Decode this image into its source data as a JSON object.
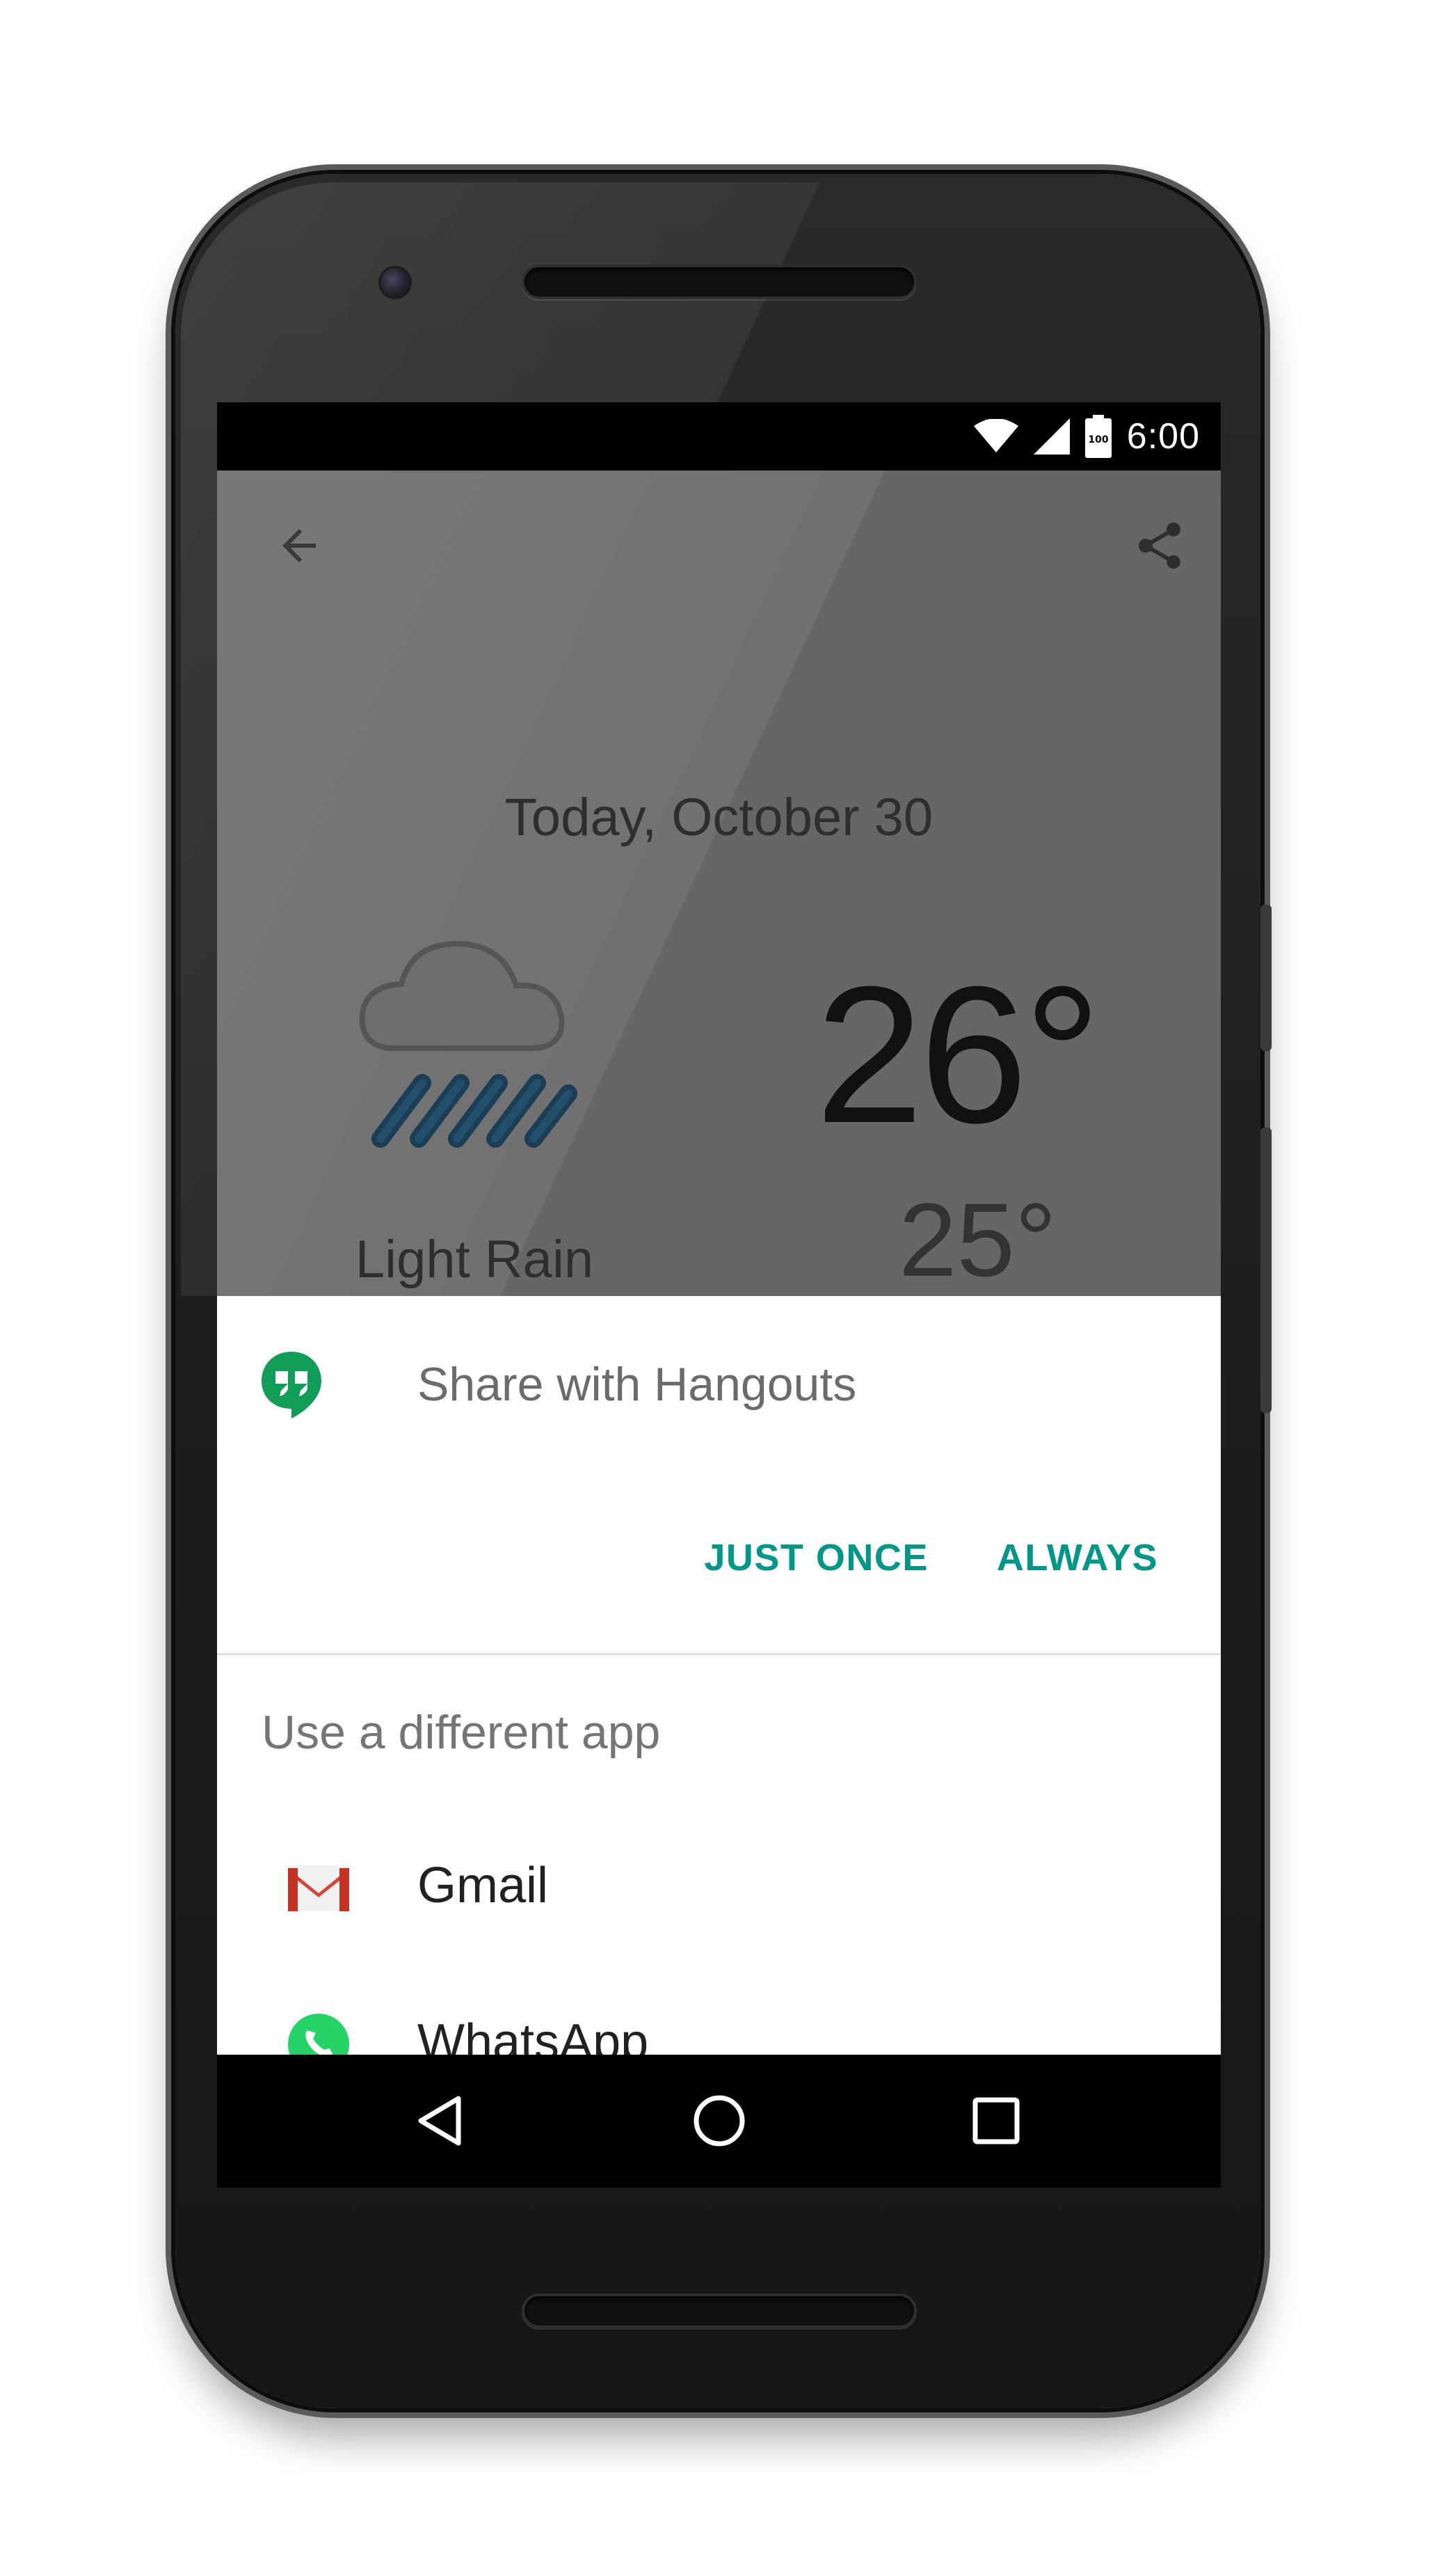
{
  "status_bar": {
    "time": "6:00",
    "battery_label": "100",
    "icons": [
      "wifi-icon",
      "cell-signal-icon",
      "battery-icon"
    ]
  },
  "toolbar": {
    "back_icon": "arrow-back-icon",
    "share_icon": "share-icon"
  },
  "weather": {
    "date": "Today, October 30",
    "high": "26°",
    "low": "25°",
    "condition": "Light Rain",
    "icon": "light-rain-icon"
  },
  "share_sheet": {
    "title": "Share with Hangouts",
    "title_icon": "hangouts-icon",
    "just_once": "JUST ONCE",
    "always": "ALWAYS",
    "different_app_label": "Use a different app",
    "apps": [
      {
        "name": "Gmail",
        "icon": "gmail-icon"
      },
      {
        "name": "WhatsApp",
        "icon": "whatsapp-icon"
      }
    ]
  },
  "colors": {
    "accent": "#009688",
    "hangouts_green": "#0F9D58",
    "gmail_red": "#D44638",
    "whatsapp_green": "#25D366",
    "dim_overlay": "#666666"
  },
  "nav_bar": {
    "icons": [
      "nav-back-icon",
      "nav-home-icon",
      "nav-recents-icon"
    ]
  }
}
